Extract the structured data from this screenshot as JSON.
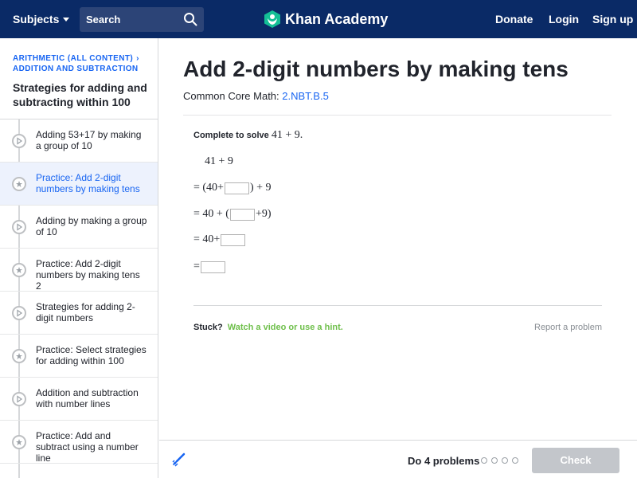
{
  "header": {
    "subjects_label": "Subjects",
    "search_label": "Search",
    "logo_text": "Khan Academy",
    "nav": {
      "donate": "Donate",
      "login": "Login",
      "signup": "Sign up"
    },
    "bg_color": "#0a2a66"
  },
  "sidebar": {
    "breadcrumb": [
      "ARITHMETIC (ALL CONTENT)",
      "ADDITION AND SUBTRACTION"
    ],
    "unit_title": "Strategies for adding and subtracting within 100",
    "items": [
      {
        "label": "Adding 53+17 by making a group of 10",
        "icon": "play-icon",
        "active": false
      },
      {
        "label": "Practice: Add 2-digit numbers by making tens",
        "icon": "star-icon",
        "active": true
      },
      {
        "label": "Adding by making a group of 10",
        "icon": "play-icon",
        "active": false
      },
      {
        "label": "Practice: Add 2-digit numbers by making tens 2",
        "icon": "star-icon",
        "active": false
      },
      {
        "label": "Strategies for adding 2-digit numbers",
        "icon": "play-icon",
        "active": false
      },
      {
        "label": "Practice: Select strategies for adding within 100",
        "icon": "star-icon",
        "active": false
      },
      {
        "label": "Addition and subtraction with number lines",
        "icon": "play-icon",
        "active": false
      },
      {
        "label": "Practice: Add and subtract using a number line",
        "icon": "star-icon",
        "active": false
      }
    ]
  },
  "main": {
    "title": "Add 2-digit numbers by making tens",
    "standard_prefix": "Common Core Math:",
    "standard_code": "2.NBT.B.5",
    "prompt_text": "Complete to solve",
    "prompt_expr": "41 + 9.",
    "steps": {
      "line1": "41 + 9",
      "line2_a": "= (40+",
      "line2_b": ") + 9",
      "line3_a": "= 40 + (",
      "line3_b": "+9)",
      "line4_a": "= 40+",
      "line5_a": "="
    },
    "stuck_label": "Stuck?",
    "hint_link": "Watch a video or use a hint.",
    "report_link": "Report a problem"
  },
  "footer": {
    "do_label": "Do 4 problems",
    "progress_total": 4,
    "progress_done": 0,
    "check_label": "Check"
  }
}
